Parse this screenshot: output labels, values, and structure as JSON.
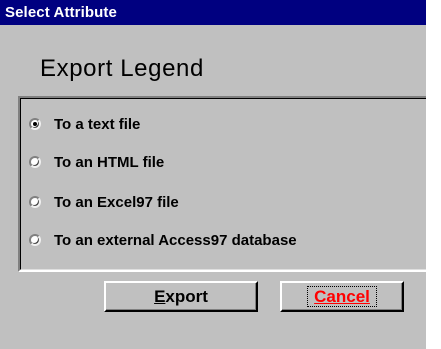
{
  "window": {
    "title": "Select Attribute"
  },
  "heading": "Export Legend",
  "options": [
    {
      "label": "To a text file",
      "checked": true
    },
    {
      "label": "To an HTML file",
      "checked": false
    },
    {
      "label": "To an Excel97 file",
      "checked": false
    },
    {
      "label": "To an external Access97 database",
      "checked": false
    }
  ],
  "buttons": {
    "export": {
      "accel": "E",
      "rest": "xport"
    },
    "cancel": {
      "label": "Cancel",
      "color": "#ff0000"
    }
  },
  "colors": {
    "titlebar": "#000080",
    "dialog_bg": "#c0c0c0"
  }
}
